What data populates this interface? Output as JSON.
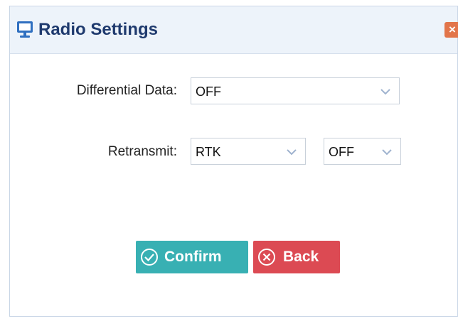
{
  "dialog": {
    "title": "Radio Settings",
    "close_symbol": "×"
  },
  "form": {
    "differential_data": {
      "label": "Differential Data:",
      "selected": "OFF"
    },
    "retransmit": {
      "label": "Retransmit:",
      "mode_selected": "RTK",
      "state_selected": "OFF"
    }
  },
  "buttons": {
    "confirm_label": "Confirm",
    "back_label": "Back"
  },
  "icons": {
    "title": "monitor-icon",
    "close": "close-icon",
    "dropdown": "chevron-down-icon",
    "confirm": "check-circle-icon",
    "back": "x-circle-icon"
  },
  "colors": {
    "title_text": "#1f3a6e",
    "titlebar_bg": "#edf3fa",
    "close_button": "#e2754a",
    "confirm_button": "#38b0b3",
    "back_button": "#dc4a53"
  }
}
